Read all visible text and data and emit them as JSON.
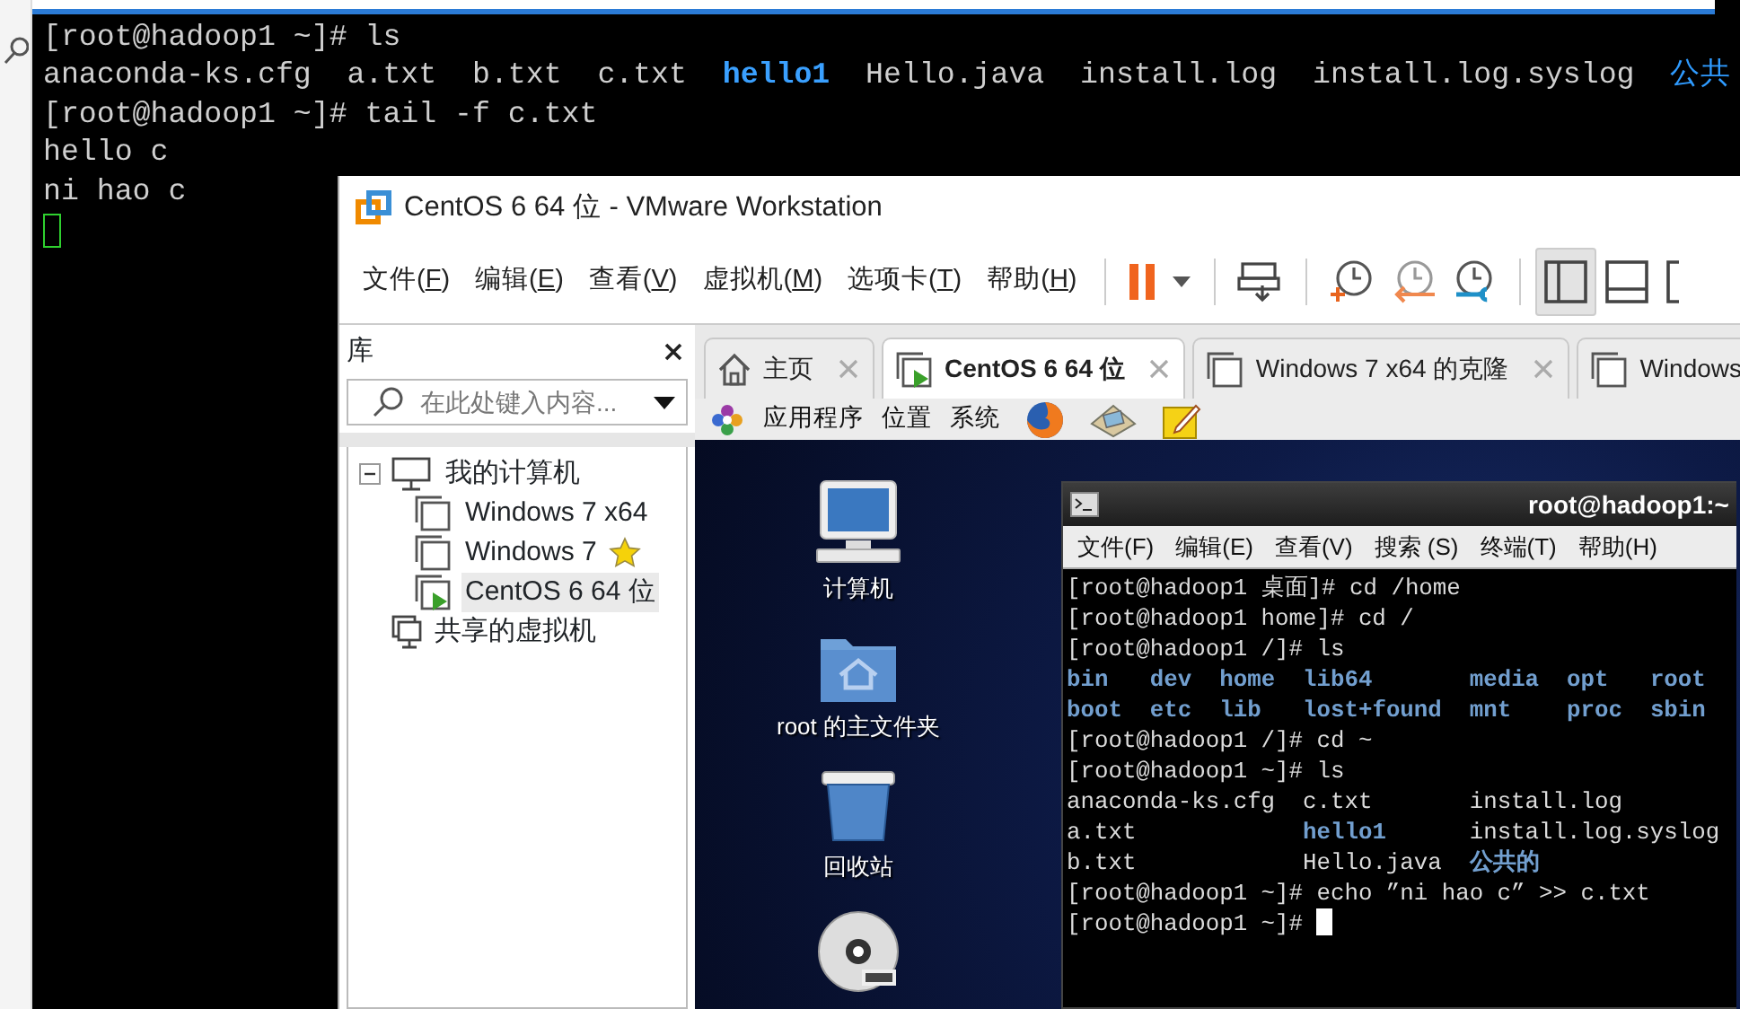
{
  "background_terminal": {
    "lines": [
      {
        "kind": "text",
        "text": "[root@hadoop1 ~]# ls"
      },
      {
        "kind": "listing",
        "items": [
          {
            "text": "anaconda-ks.cfg",
            "kind": "file"
          },
          {
            "text": "a.txt",
            "kind": "file"
          },
          {
            "text": "b.txt",
            "kind": "file"
          },
          {
            "text": "c.txt",
            "kind": "file"
          },
          {
            "text": "hello1",
            "kind": "bold"
          },
          {
            "text": "Hello.java",
            "kind": "file"
          },
          {
            "text": "install.log",
            "kind": "file"
          },
          {
            "text": "install.log.syslog",
            "kind": "file"
          },
          {
            "text": "公共",
            "kind": "dir"
          }
        ]
      },
      {
        "kind": "text",
        "text": "[root@hadoop1 ~]# tail -f c.txt"
      },
      {
        "kind": "text",
        "text": "hello c"
      },
      {
        "kind": "text",
        "text": "ni hao c"
      },
      {
        "kind": "cursor"
      }
    ]
  },
  "vmware": {
    "title": "CentOS 6 64 位 - VMware Workstation",
    "menu": [
      {
        "text": "文件(",
        "key": "F",
        "tail": ")"
      },
      {
        "text": "编辑(",
        "key": "E",
        "tail": ")"
      },
      {
        "text": "查看(",
        "key": "V",
        "tail": ")"
      },
      {
        "text": "虚拟机(",
        "key": "M",
        "tail": ")"
      },
      {
        "text": "选项卡(",
        "key": "T",
        "tail": ")"
      },
      {
        "text": "帮助(",
        "key": "H",
        "tail": ")"
      }
    ],
    "toolbar": [
      {
        "kind": "separator"
      },
      {
        "kind": "pause",
        "selected": false
      },
      {
        "kind": "caret",
        "selected": false
      },
      {
        "kind": "separator"
      },
      {
        "kind": "send-keys",
        "selected": false
      },
      {
        "kind": "separator"
      },
      {
        "kind": "snapshot-take",
        "selected": false
      },
      {
        "kind": "snapshot-revert",
        "selected": false
      },
      {
        "kind": "snapshot-manage",
        "selected": false
      },
      {
        "kind": "separator"
      },
      {
        "kind": "view-sidebar",
        "selected": true
      },
      {
        "kind": "view-bottom",
        "selected": false
      },
      {
        "kind": "view-full",
        "selected": false
      }
    ],
    "library": {
      "title": "库",
      "search": {
        "placeholder": "在此处键入内容..."
      },
      "tree": [
        {
          "label": "我的计算机",
          "kind": "computer",
          "expanded": true,
          "selected": false,
          "children": [
            {
              "label": "Windows 7 x64",
              "kind": "vm",
              "favorite": false,
              "running": false,
              "selected": false
            },
            {
              "label": "Windows 7",
              "kind": "vm",
              "favorite": true,
              "running": false,
              "selected": false
            },
            {
              "label": "CentOS 6 64 位",
              "kind": "vm",
              "favorite": false,
              "running": true,
              "selected": true
            }
          ]
        },
        {
          "label": "共享的虚拟机",
          "kind": "shared",
          "selected": false
        }
      ]
    },
    "tabs": [
      {
        "label": "主页",
        "kind": "home",
        "selected": false,
        "closable": true
      },
      {
        "label": "CentOS 6 64 位",
        "kind": "running-vm",
        "selected": true,
        "closable": true
      },
      {
        "label": "Windows 7 x64 的克隆",
        "kind": "vm",
        "selected": false,
        "closable": true
      },
      {
        "label": "Windows",
        "kind": "vm",
        "selected": false,
        "closable": false
      }
    ],
    "guest": {
      "panel": {
        "menus": [
          "应用程序",
          "位置",
          "系统"
        ],
        "launchers": [
          {
            "kind": "browser"
          },
          {
            "kind": "photos"
          },
          {
            "kind": "notes"
          }
        ]
      },
      "desktop_icons": [
        {
          "label": "计算机",
          "kind": "computer"
        },
        {
          "label": "root 的主文件夹",
          "kind": "home-folder"
        },
        {
          "label": "回收站",
          "kind": "trash"
        },
        {
          "kind": "dvd"
        }
      ],
      "terminal": {
        "title": "root@hadoop1:~",
        "menu": [
          "文件(F)",
          "编辑(E)",
          "查看(V)",
          "搜索 (S)",
          "终端(T)",
          "帮助(H)"
        ],
        "lines": [
          {
            "kind": "text",
            "text": "[root@hadoop1 桌面]# cd /home"
          },
          {
            "kind": "text",
            "text": "[root@hadoop1 home]# cd /"
          },
          {
            "kind": "text",
            "text": "[root@hadoop1 /]# ls"
          },
          {
            "kind": "columns",
            "columns": [
              [
                {
                  "text": "bin",
                  "kind": "dir"
                },
                {
                  "text": "boot",
                  "kind": "dir"
                }
              ],
              [
                {
                  "text": "dev",
                  "kind": "dir"
                },
                {
                  "text": "etc",
                  "kind": "dir"
                }
              ],
              [
                {
                  "text": "home",
                  "kind": "dir"
                },
                {
                  "text": "lib",
                  "kind": "dir"
                }
              ],
              [
                {
                  "text": "lib64",
                  "kind": "dir"
                },
                {
                  "text": "lost+found",
                  "kind": "dir"
                }
              ],
              [
                {
                  "text": "media",
                  "kind": "dir"
                },
                {
                  "text": "mnt",
                  "kind": "dir"
                }
              ],
              [
                {
                  "text": "opt",
                  "kind": "dir"
                },
                {
                  "text": "proc",
                  "kind": "dir"
                }
              ],
              [
                {
                  "text": "root",
                  "kind": "dir"
                },
                {
                  "text": "sbin",
                  "kind": "dir"
                }
              ]
            ]
          },
          {
            "kind": "text",
            "text": "[root@hadoop1 /]# cd ~"
          },
          {
            "kind": "text",
            "text": "[root@hadoop1 ~]# ls"
          },
          {
            "kind": "columns",
            "columns": [
              [
                {
                  "text": "anaconda-ks.cfg",
                  "kind": "file"
                },
                {
                  "text": "a.txt",
                  "kind": "file"
                },
                {
                  "text": "b.txt",
                  "kind": "file"
                }
              ],
              [
                {
                  "text": "c.txt",
                  "kind": "file"
                },
                {
                  "text": "hello1",
                  "kind": "dir"
                },
                {
                  "text": "Hello.java",
                  "kind": "file"
                }
              ],
              [
                {
                  "text": "install.log",
                  "kind": "file"
                },
                {
                  "text": "install.log.syslog",
                  "kind": "file"
                },
                {
                  "text": "公共的",
                  "kind": "dir"
                }
              ]
            ]
          },
          {
            "kind": "text",
            "text": "[root@hadoop1 ~]# echo ”ni hao c” >> c.txt"
          },
          {
            "kind": "input",
            "text": "[root@hadoop1 ~]#"
          }
        ]
      }
    }
  }
}
